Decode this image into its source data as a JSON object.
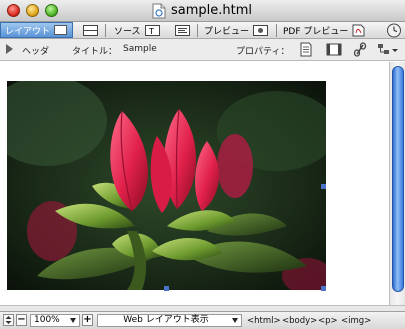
{
  "window": {
    "title": "sample.html"
  },
  "modebar": {
    "tabs": [
      {
        "label": "レイアウト",
        "icon": "layout-view-icon",
        "active": true
      },
      {
        "label": "",
        "icon": "split-view-icon",
        "active": false
      },
      {
        "label": "ソース",
        "icon": "source-view-icon",
        "active": false
      },
      {
        "label": "",
        "icon": "source-format-icon",
        "active": false
      },
      {
        "label": "プレビュー",
        "icon": "preview-icon",
        "active": false
      },
      {
        "label": "PDF プレビュー",
        "icon": "pdf-icon",
        "active": false
      }
    ]
  },
  "infobar": {
    "header_label": "ヘッダ",
    "title_label": "タイトル：",
    "title_value": "Sample",
    "properties_label": "プロパティ："
  },
  "statusbar": {
    "zoom": "100%",
    "view_mode": "Web レイアウト表示",
    "tags": [
      "<html>",
      "<body>",
      "<p>",
      "<img>"
    ]
  },
  "colors": {
    "accent": "#5a93d6",
    "handle": "#4a72c6",
    "scroll": "#3b7ae0"
  }
}
